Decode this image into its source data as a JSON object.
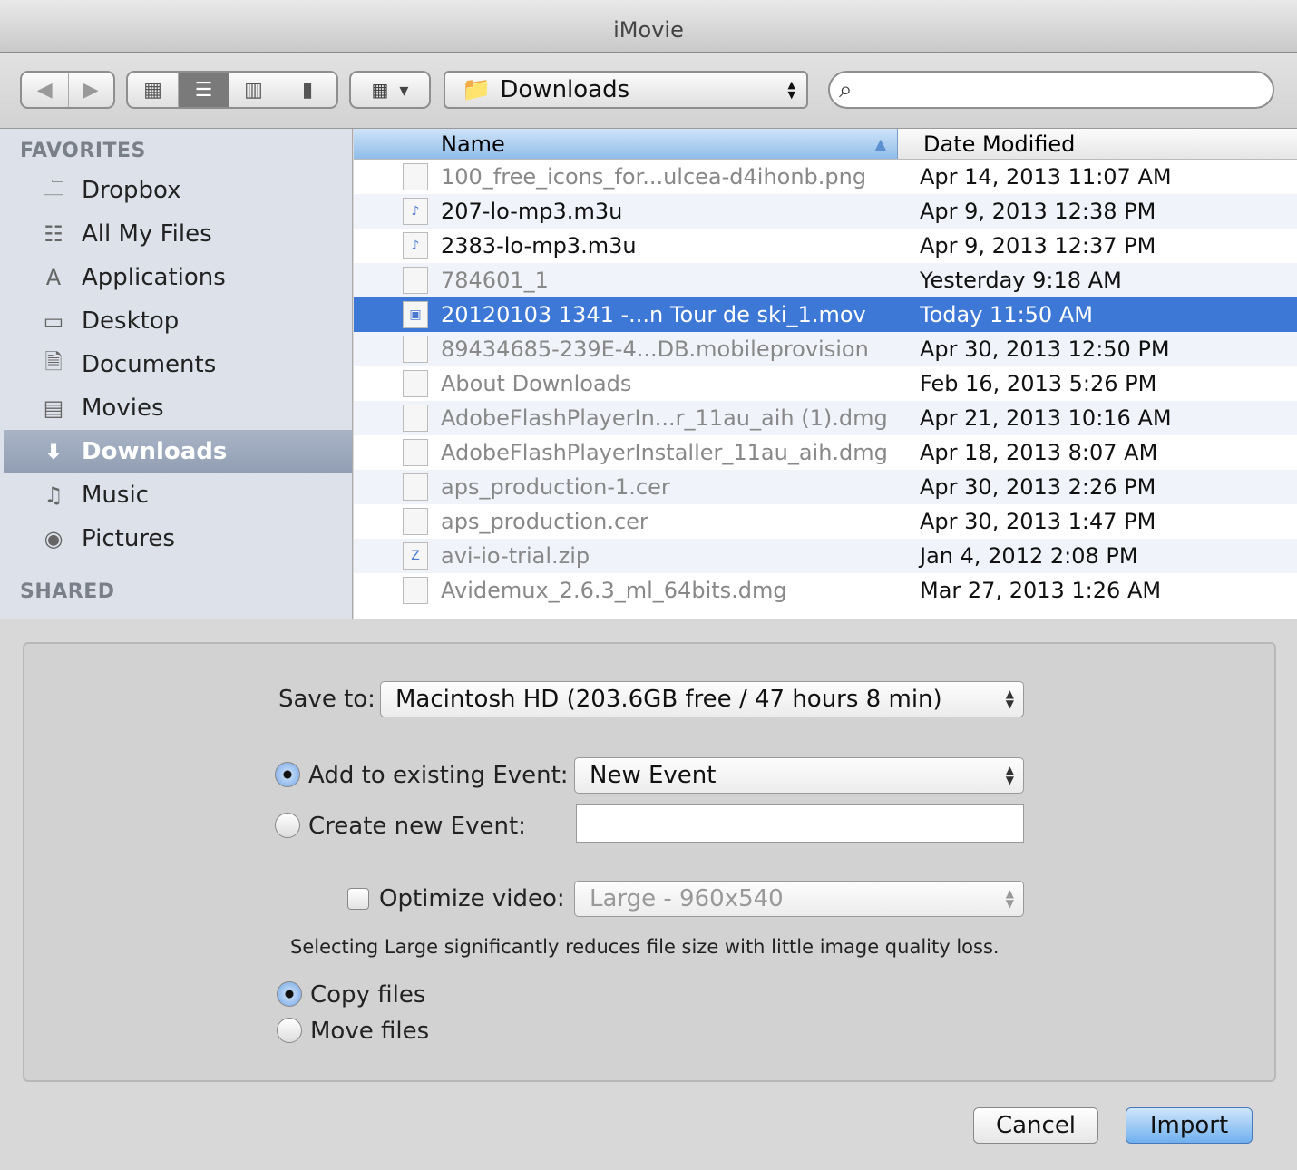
{
  "window": {
    "title": "iMovie"
  },
  "toolbar": {
    "location": "Downloads",
    "search_placeholder": ""
  },
  "sidebar": {
    "favorites_header": "FAVORITES",
    "shared_header": "SHARED",
    "items": [
      {
        "label": "Dropbox",
        "icon": "folder-icon"
      },
      {
        "label": "All My Files",
        "icon": "all-files-icon"
      },
      {
        "label": "Applications",
        "icon": "applications-icon"
      },
      {
        "label": "Desktop",
        "icon": "desktop-icon"
      },
      {
        "label": "Documents",
        "icon": "documents-icon"
      },
      {
        "label": "Movies",
        "icon": "movies-icon"
      },
      {
        "label": "Downloads",
        "icon": "downloads-icon",
        "selected": true
      },
      {
        "label": "Music",
        "icon": "music-icon"
      },
      {
        "label": "Pictures",
        "icon": "pictures-icon"
      }
    ]
  },
  "file_list": {
    "columns": {
      "name": "Name",
      "date": "Date Modified"
    },
    "rows": [
      {
        "name": "100_free_icons_for...ulcea-d4ihonb.png",
        "date": "Apr 14, 2013 11:07 AM"
      },
      {
        "name": "207-lo-mp3.m3u",
        "date": "Apr 9, 2013 12:38 PM"
      },
      {
        "name": "2383-lo-mp3.m3u",
        "date": "Apr 9, 2013 12:37 PM"
      },
      {
        "name": "784601_1",
        "date": "Yesterday 9:18 AM"
      },
      {
        "name": "20120103 1341 -...n Tour de ski_1.mov",
        "date": "Today 11:50 AM"
      },
      {
        "name": "89434685-239E-4...DB.mobileprovision",
        "date": "Apr 30, 2013 12:50 PM"
      },
      {
        "name": "About Downloads",
        "date": "Feb 16, 2013 5:26 PM"
      },
      {
        "name": "AdobeFlashPlayerIn...r_11au_aih (1).dmg",
        "date": "Apr 21, 2013 10:16 AM"
      },
      {
        "name": "AdobeFlashPlayerInstaller_11au_aih.dmg",
        "date": "Apr 18, 2013 8:07 AM"
      },
      {
        "name": "aps_production-1.cer",
        "date": "Apr 30, 2013 2:26 PM"
      },
      {
        "name": "aps_production.cer",
        "date": "Apr 30, 2013 1:47 PM"
      },
      {
        "name": "avi-io-trial.zip",
        "date": "Jan 4, 2012 2:08 PM"
      },
      {
        "name": "Avidemux_2.6.3_ml_64bits.dmg",
        "date": "Mar 27, 2013 1:26 AM"
      }
    ]
  },
  "import": {
    "save_to_label": "Save to:",
    "save_to_value": "Macintosh HD (203.6GB free / 47 hours 8 min)",
    "add_existing_label": "Add to existing Event:",
    "existing_event_value": "New Event",
    "create_new_label": "Create new Event:",
    "new_event_value": "",
    "optimize_label": "Optimize video:",
    "optimize_value": "Large - 960x540",
    "optimize_note": "Selecting Large significantly reduces file size with little image quality loss.",
    "copy_label": "Copy files",
    "move_label": "Move files",
    "cancel": "Cancel",
    "import": "Import"
  }
}
